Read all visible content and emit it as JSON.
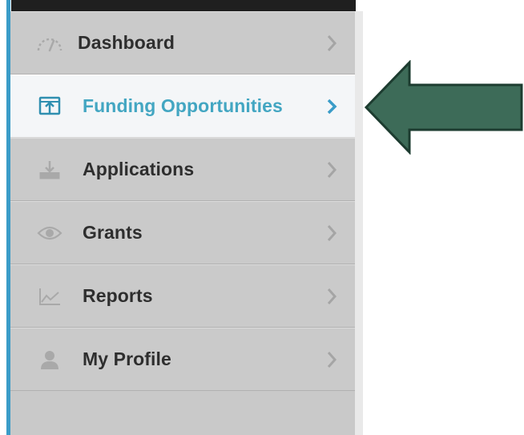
{
  "sidebar": {
    "items": [
      {
        "label": "Dashboard",
        "icon": "speedometer-icon",
        "active": false
      },
      {
        "label": "Funding Opportunities",
        "icon": "upload-screen-icon",
        "active": true
      },
      {
        "label": "Applications",
        "icon": "download-tray-icon",
        "active": false
      },
      {
        "label": "Grants",
        "icon": "eye-icon",
        "active": false
      },
      {
        "label": "Reports",
        "icon": "line-chart-icon",
        "active": false
      },
      {
        "label": "My Profile",
        "icon": "user-icon",
        "active": false
      }
    ]
  },
  "colors": {
    "accent": "#3a9cc8",
    "active_text": "#43a6c2",
    "arrow_fill": "#3d6b58",
    "arrow_stroke": "#1d3c30"
  }
}
